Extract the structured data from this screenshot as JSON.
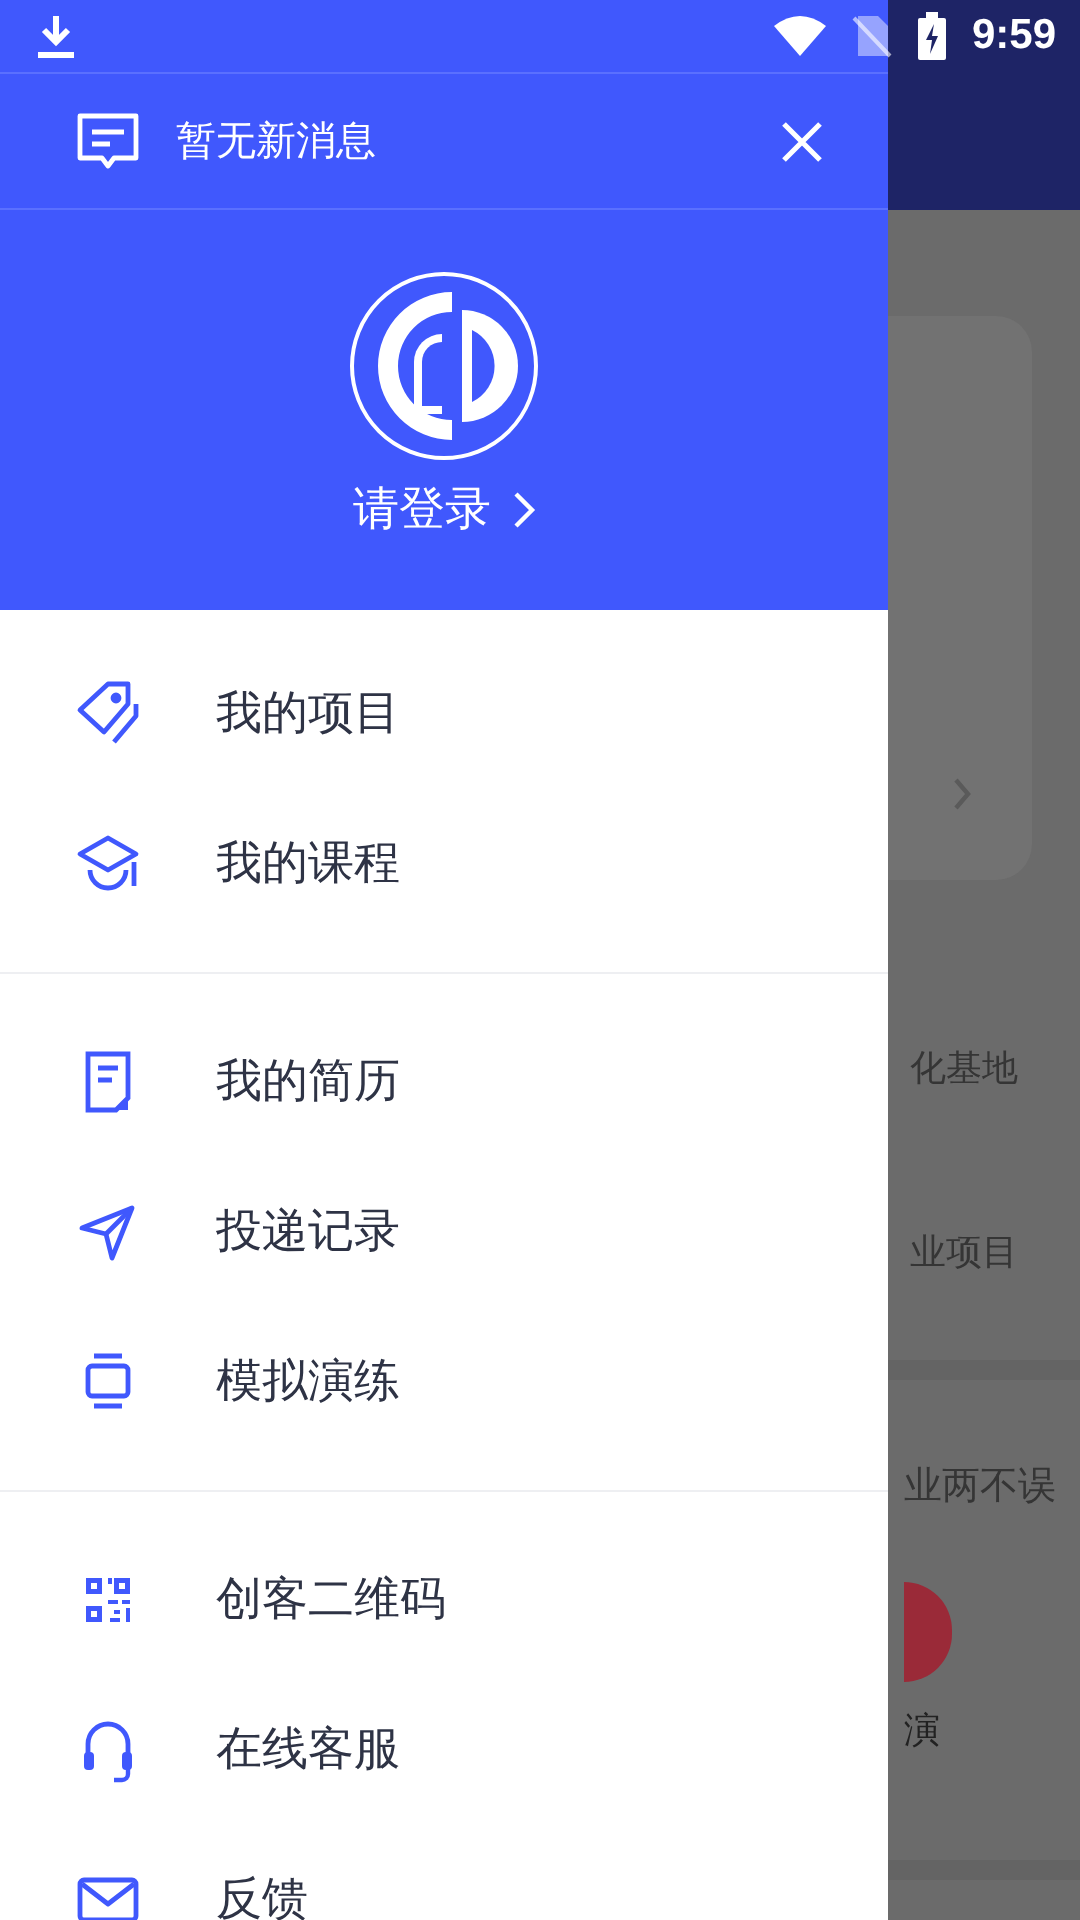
{
  "status_bar": {
    "time": "9:59"
  },
  "drawer": {
    "message": "暂无新消息",
    "login": "请登录",
    "groups": [
      {
        "items": [
          {
            "label": "我的项目"
          },
          {
            "label": "我的课程"
          }
        ]
      },
      {
        "items": [
          {
            "label": "我的简历"
          },
          {
            "label": "投递记录"
          },
          {
            "label": "模拟演练"
          }
        ]
      },
      {
        "items": [
          {
            "label": "创客二维码"
          },
          {
            "label": "在线客服"
          },
          {
            "label": "反馈"
          }
        ]
      }
    ]
  },
  "backdrop": {
    "stats": [
      {
        "label": "化基地"
      },
      {
        "label": "业项目"
      }
    ],
    "banner": "业两不误",
    "shortcut": "演"
  }
}
